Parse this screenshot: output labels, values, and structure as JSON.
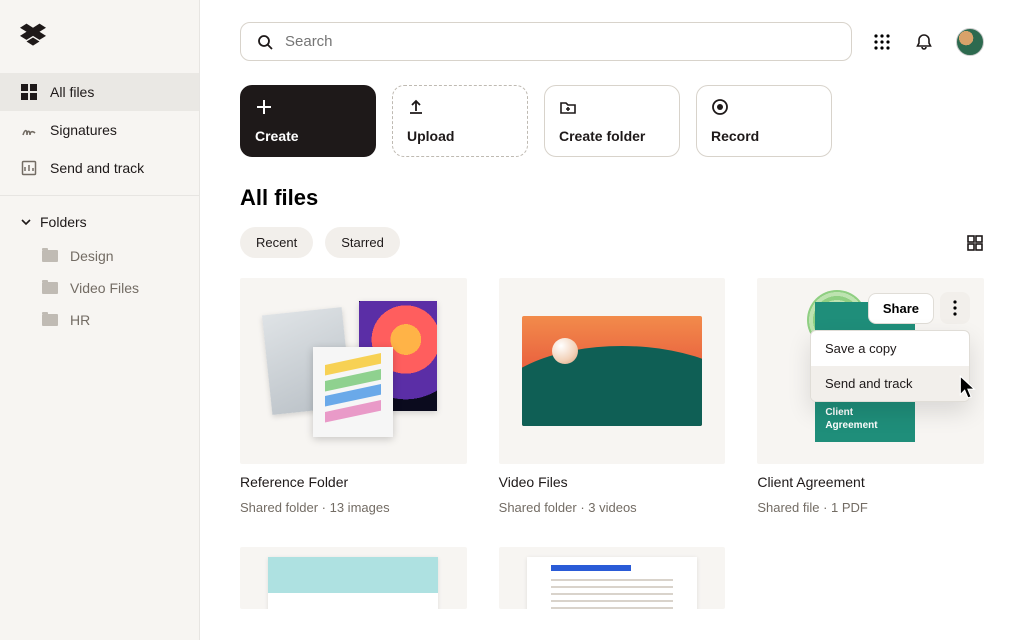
{
  "search": {
    "placeholder": "Search"
  },
  "sidebar": {
    "nav": {
      "all_files": "All files",
      "signatures": "Signatures",
      "send_track": "Send and track"
    },
    "folders_header": "Folders",
    "folders": [
      {
        "label": "Design"
      },
      {
        "label": "Video Files"
      },
      {
        "label": "HR"
      }
    ]
  },
  "actions": {
    "create": "Create",
    "upload": "Upload",
    "create_folder": "Create folder",
    "record": "Record"
  },
  "page_title": "All files",
  "filters": {
    "recent": "Recent",
    "starred": "Starred"
  },
  "share_label": "Share",
  "card3_menu": {
    "save_copy": "Save a copy",
    "send_track": "Send and track"
  },
  "doc_text": {
    "line1": "Client",
    "line2": "Agreement"
  },
  "cards": [
    {
      "title": "Reference Folder",
      "meta": "Shared folder · 13 images"
    },
    {
      "title": "Video Files",
      "meta": "Shared folder · 3 videos"
    },
    {
      "title": "Client Agreement",
      "meta": "Shared file · 1 PDF"
    }
  ]
}
